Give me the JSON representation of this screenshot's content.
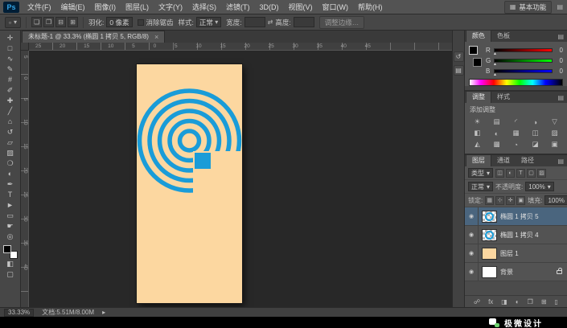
{
  "colors": {
    "accent_blue": "#1a9cd8",
    "document_bg": "#fcd7a0",
    "canvas_bg": "#282828",
    "panel_bg": "#535353",
    "selected_layer_bg": "#4a657e"
  },
  "ui": {
    "dropdown": "▾",
    "menu": "▤",
    "workspace_icon": "▦"
  },
  "menubar": {
    "logo": "Ps",
    "items": [
      {
        "label": "文件(F)"
      },
      {
        "label": "编辑(E)"
      },
      {
        "label": "图像(I)"
      },
      {
        "label": "图层(L)"
      },
      {
        "label": "文字(Y)"
      },
      {
        "label": "选择(S)"
      },
      {
        "label": "滤镜(T)"
      },
      {
        "label": "3D(D)"
      },
      {
        "label": "视图(V)"
      },
      {
        "label": "窗口(W)"
      },
      {
        "label": "帮助(H)"
      }
    ],
    "workspace": "基本功能"
  },
  "optionsbar": {
    "tool_glyph": "▫",
    "mode_icons": [
      "❏",
      "❐",
      "⊟",
      "⊞"
    ],
    "feather_label": "羽化:",
    "feather_value": "0 像素",
    "antialias": "消除锯齿",
    "style_label": "样式:",
    "style_value": "正常",
    "width_label": "宽度:",
    "swap_glyph": "⇄",
    "height_label": "高度:",
    "refine_edge": "调整边缘…"
  },
  "document_tab": {
    "title": "未标题-1 @ 33.3% (椭圆 1 拷贝 5, RGB/8)",
    "close": "×"
  },
  "rulers": {
    "horizontal": "25 20 15 10 5 0 5 10 15 20 25 30 35 40 45",
    "vertical": "5 0 5 10 15 20 25 30 35 40"
  },
  "toolbar": {
    "tools": [
      {
        "name": "move",
        "glyph": "✛"
      },
      {
        "name": "marquee",
        "glyph": "□"
      },
      {
        "name": "lasso",
        "glyph": "∿"
      },
      {
        "name": "quick-selection",
        "glyph": "✎"
      },
      {
        "name": "crop",
        "glyph": "#"
      },
      {
        "name": "eyedropper",
        "glyph": "✐"
      },
      {
        "name": "healing-brush",
        "glyph": "✚"
      },
      {
        "name": "brush",
        "glyph": "╱"
      },
      {
        "name": "clone-stamp",
        "glyph": "⌂"
      },
      {
        "name": "history-brush",
        "glyph": "↺"
      },
      {
        "name": "eraser",
        "glyph": "▱"
      },
      {
        "name": "gradient",
        "glyph": "▨"
      },
      {
        "name": "blur",
        "glyph": "❍"
      },
      {
        "name": "dodge",
        "glyph": "◐"
      },
      {
        "name": "pen",
        "glyph": "✒"
      },
      {
        "name": "type",
        "glyph": "T"
      },
      {
        "name": "path-selection",
        "glyph": "►"
      },
      {
        "name": "shape",
        "glyph": "▭"
      },
      {
        "name": "hand",
        "glyph": "☛"
      },
      {
        "name": "zoom",
        "glyph": "◎"
      }
    ],
    "extra": [
      {
        "name": "quick-mask",
        "glyph": "◧"
      },
      {
        "name": "screen-mode",
        "glyph": "▢"
      }
    ]
  },
  "dock": {
    "icons": [
      {
        "name": "history-panel",
        "glyph": "↺"
      },
      {
        "name": "properties-panel",
        "glyph": "▤"
      }
    ]
  },
  "color_panel": {
    "tabs": [
      "颜色",
      "色板"
    ],
    "channels": [
      {
        "label": "R",
        "value": "0"
      },
      {
        "label": "G",
        "value": "0"
      },
      {
        "label": "B",
        "value": "0"
      }
    ]
  },
  "adjustments_panel": {
    "tabs": [
      "调整",
      "样式"
    ],
    "title": "添加调整",
    "icons": [
      "☀",
      "▤",
      "◜",
      "◑",
      "▽",
      "◧",
      "◐",
      "▦",
      "◫",
      "▨",
      "◭",
      "▩",
      "◔",
      "◪",
      "▣"
    ]
  },
  "layers_panel": {
    "tabs": [
      "图层",
      "通道",
      "路径"
    ],
    "filter_label": "类型",
    "filter_icons": [
      "◫",
      "◐",
      "T",
      "▢",
      "▨"
    ],
    "blend_mode": "正常",
    "opacity_label": "不透明度:",
    "opacity_value": "100%",
    "lock_label": "锁定:",
    "lock_icons": [
      "▦",
      "⊹",
      "✛",
      "▣"
    ],
    "fill_label": "填充:",
    "fill_value": "100%",
    "eye_glyph": "◉",
    "rows": [
      {
        "name": "椭圆 1 拷贝 5"
      },
      {
        "name": "椭圆 1 拷贝 4"
      },
      {
        "name": "图层 1"
      },
      {
        "name": "背景"
      }
    ],
    "bottom_icons": [
      {
        "name": "link-layers",
        "glyph": "☍"
      },
      {
        "name": "layer-style",
        "glyph": "fx"
      },
      {
        "name": "layer-mask",
        "glyph": "◨"
      },
      {
        "name": "adjustment-layer",
        "glyph": "◐"
      },
      {
        "name": "layer-group",
        "glyph": "❐"
      },
      {
        "name": "new-layer",
        "glyph": "⊞"
      },
      {
        "name": "delete-layer",
        "glyph": "▯"
      }
    ]
  },
  "statusbar": {
    "zoom": "33.33%",
    "doc_info": "文档:5.51M/8.00M",
    "arrow": "▸"
  },
  "watermark": {
    "text": "极微设计"
  }
}
